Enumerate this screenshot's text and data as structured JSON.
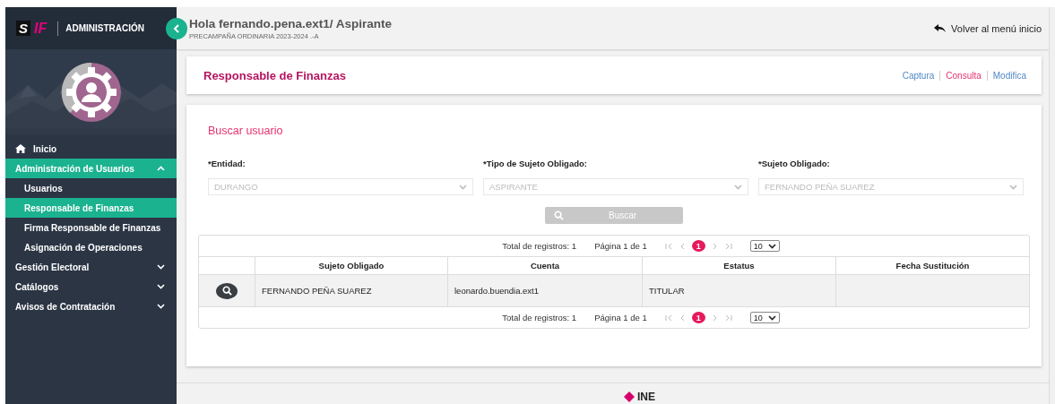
{
  "sidebar": {
    "logo": {
      "mark": "S",
      "accent": "IF"
    },
    "title": "ADMINISTRACIÓN",
    "items": [
      {
        "kind": "link",
        "label": "Inicio",
        "selected": false
      },
      {
        "kind": "group",
        "label": "Administración de Usuarios",
        "selected": true,
        "expanded": true,
        "children": [
          {
            "label": "Usuarios",
            "selected": false
          },
          {
            "label": "Responsable de Finanzas",
            "selected": true
          },
          {
            "label": "Firma Responsable de Finanzas",
            "selected": false
          },
          {
            "label": "Asignación de Operaciones",
            "selected": false
          }
        ]
      },
      {
        "kind": "group",
        "label": "Gestión Electoral",
        "selected": false,
        "expanded": false
      },
      {
        "kind": "group",
        "label": "Catálogos",
        "selected": false,
        "expanded": false
      },
      {
        "kind": "group",
        "label": "Avisos de Contratación",
        "selected": false,
        "expanded": false
      }
    ]
  },
  "header": {
    "greeting": "Hola fernando.pena.ext1/ Aspirante",
    "subtitle": "PRECAMPAÑA ORDINARIA 2023-2024 .-A",
    "back_link": "Volver al menú inicio"
  },
  "page": {
    "title": "Responsable de Finanzas",
    "actions": [
      {
        "label": "Captura",
        "selected": false
      },
      {
        "label": "Consulta",
        "selected": true
      },
      {
        "label": "Modifica",
        "selected": false
      }
    ]
  },
  "search": {
    "title": "Buscar usuario",
    "fields": [
      {
        "label": "*Entidad:",
        "value": "DURANGO",
        "disabled": true
      },
      {
        "label": "*Tipo de Sujeto Obligado:",
        "value": "ASPIRANTE",
        "disabled": true
      },
      {
        "label": "*Sujeto Obligado:",
        "value": "FERNANDO PEÑA SUAREZ",
        "disabled": true
      }
    ],
    "button": {
      "label": "Buscar",
      "disabled": true
    }
  },
  "table": {
    "pagination_top": {
      "total": "Total de registros: 1",
      "page": "Página 1 de 1",
      "current": "1",
      "page_size": "10"
    },
    "columns": [
      "Sujeto Obligado",
      "Cuenta",
      "Estatus",
      "Fecha Sustitución"
    ],
    "rows": [
      {
        "sujeto": "FERNANDO PEÑA SUAREZ",
        "cuenta": "leonardo.buendia.ext1",
        "estatus": "TITULAR"
      }
    ],
    "pagination_bottom": {
      "total": "Total de registros: 1",
      "page": "Página 1 de 1",
      "current": "1",
      "page_size": "10"
    }
  },
  "footer": {
    "logo": "INE"
  }
}
